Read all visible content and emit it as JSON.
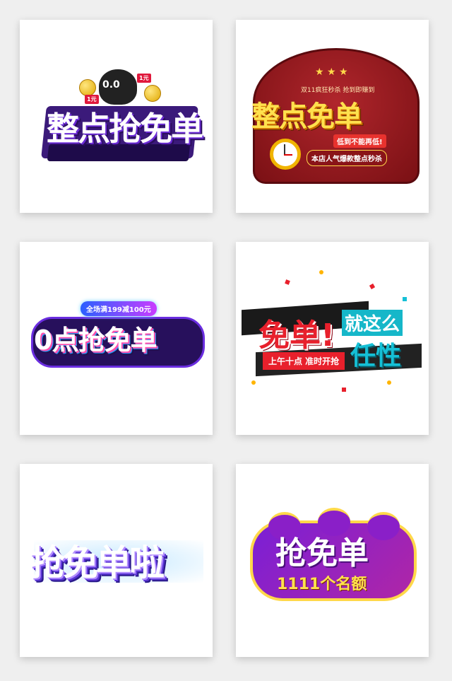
{
  "cards": [
    {
      "title": "整点抢免单",
      "tags": [
        "1元",
        "1元"
      ],
      "face": "0.0"
    },
    {
      "title": "整点免单",
      "top_line": "双11疯狂秒杀 抢到即赚到",
      "badge": "低到不能再低!",
      "subtitle": "本店人气爆款整点秒杀",
      "stars": "★ ★ ★"
    },
    {
      "title": "0点抢免单",
      "pill": "全场满199减100元"
    },
    {
      "title": "免单!",
      "right_top": "就这么",
      "right_bottom": "任性",
      "banner": "上午十点 准时开抢"
    },
    {
      "title": "抢免单啦"
    },
    {
      "title": "抢免单",
      "subtitle": "1111个名额"
    }
  ],
  "colors": {
    "page_bg": "#efefef",
    "card_bg": "#ffffff",
    "accent_purple": "#6b2bd6",
    "accent_red": "#e8202c",
    "accent_yellow": "#ffe14d",
    "accent_cyan": "#15c0d6"
  }
}
